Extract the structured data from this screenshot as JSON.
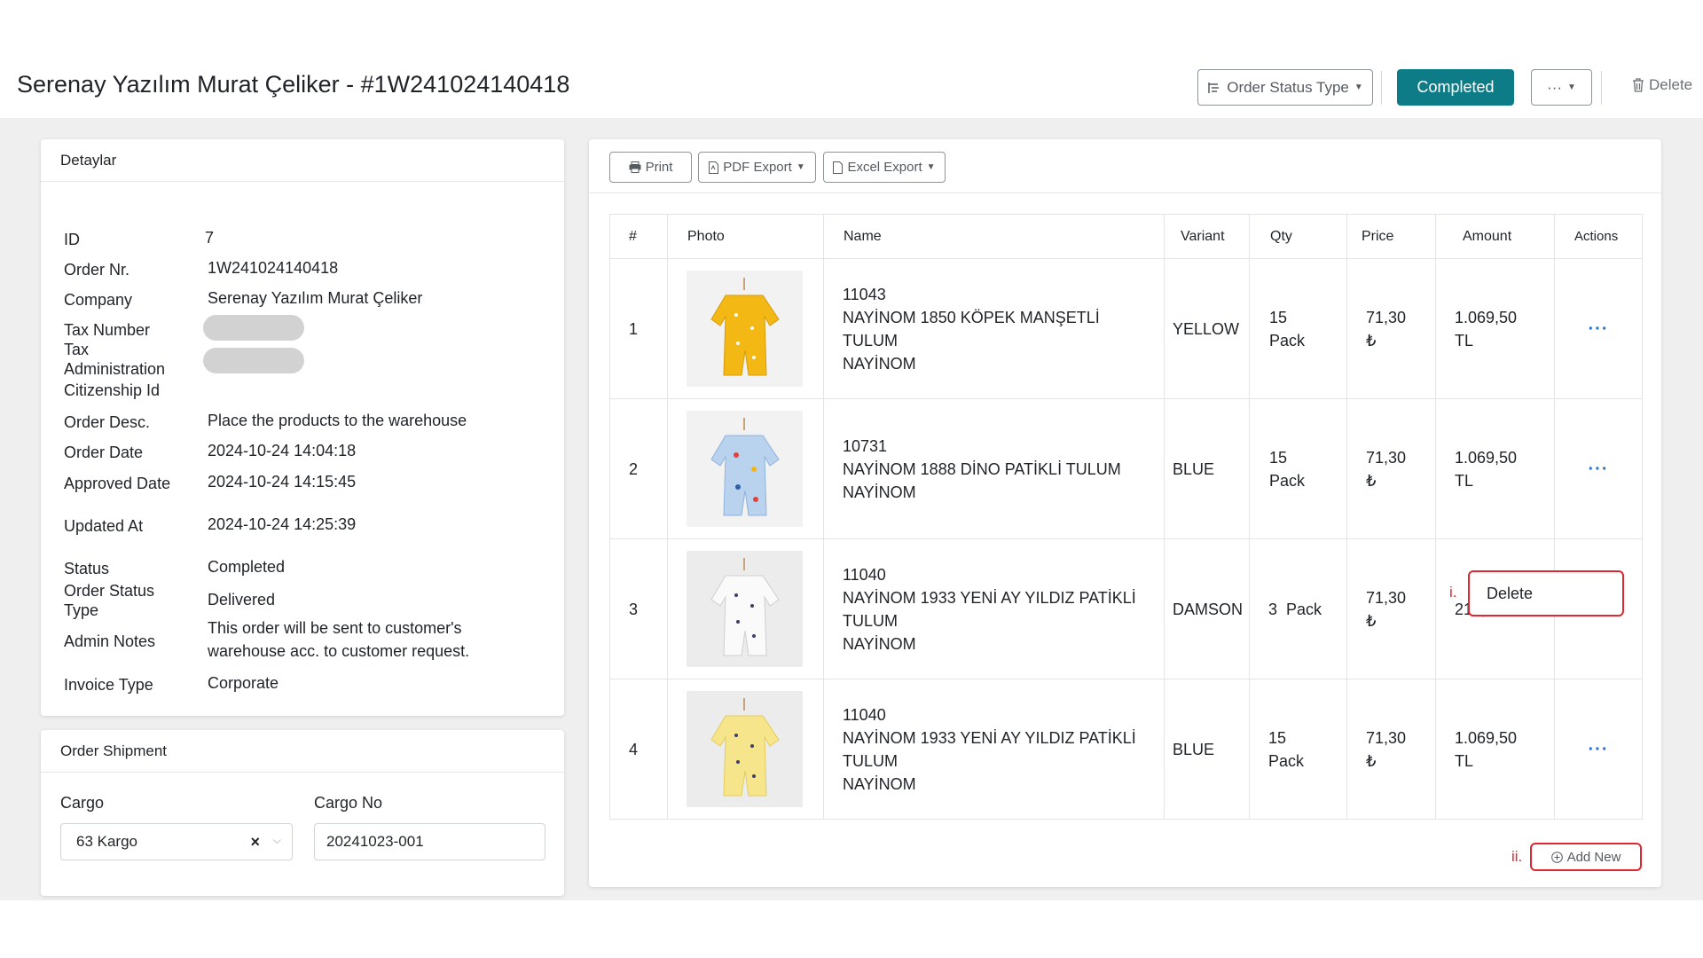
{
  "header": {
    "title": "Serenay Yazılım Murat Çeliker - #1W241024140418",
    "order_status_type_label": "Order Status Type",
    "completed_label": "Completed",
    "more_label": "···",
    "delete_label": "Delete"
  },
  "details": {
    "title": "Detaylar",
    "labels": {
      "id": "ID",
      "order_nr": "Order Nr.",
      "company": "Company",
      "tax_number": "Tax Number",
      "tax_administration": "Tax Administration",
      "citizenship_id": "Citizenship Id",
      "order_desc": "Order Desc.",
      "order_date": "Order Date",
      "approved_date": "Approved Date",
      "updated_at": "Updated At",
      "status": "Status",
      "order_status_type": "Order Status Type",
      "admin_notes": "Admin Notes",
      "invoice_type": "Invoice Type"
    },
    "values": {
      "id": "7",
      "order_nr": "1W241024140418",
      "company": "Serenay Yazılım Murat Çeliker",
      "order_desc": "Place the products to the warehouse",
      "order_date": "2024-10-24 14:04:18",
      "approved_date": "2024-10-24 14:15:45",
      "updated_at": "2024-10-24 14:25:39",
      "status": "Completed",
      "order_status_type": "Delivered",
      "admin_notes_line1": "This order will be sent to customer's",
      "admin_notes_line2": "warehouse acc. to customer request.",
      "invoice_type": "Corporate"
    }
  },
  "shipment": {
    "title": "Order Shipment",
    "cargo_label": "Cargo",
    "cargo_value": "63 Kargo",
    "cargo_no_label": "Cargo No",
    "cargo_no_value": "20241023-001"
  },
  "toolbar": {
    "print_label": "Print",
    "pdf_label": "PDF Export",
    "excel_label": "Excel Export"
  },
  "table": {
    "headers": {
      "num": "#",
      "photo": "Photo",
      "name": "Name",
      "variant": "Variant",
      "qty": "Qty",
      "price": "Price",
      "amount": "Amount",
      "actions": "Actions"
    },
    "rows": [
      {
        "num": "1",
        "code": "11043",
        "name_line1": "NAYİNOM 1850 KÖPEK MANŞETLİ",
        "name_line2": "TULUM",
        "brand": "NAYİNOM",
        "variant": "YELLOW",
        "qty_num": "15",
        "qty_unit": "Pack",
        "price_value": "71,30",
        "price_currency": "₺",
        "amount_value": "1.069,50",
        "amount_currency": "TL",
        "photo_color": "#f3b813"
      },
      {
        "num": "2",
        "code": "10731",
        "name_line1": "NAYİNOM 1888 DİNO PATİKLİ TULUM",
        "name_line2": "",
        "brand": "NAYİNOM",
        "variant": "BLUE",
        "qty_num": "15",
        "qty_unit": "Pack",
        "price_value": "71,30",
        "price_currency": "₺",
        "amount_value": "1.069,50",
        "amount_currency": "TL",
        "photo_color": "#b9d2ee"
      },
      {
        "num": "3",
        "code": "11040",
        "name_line1": "NAYİNOM 1933 YENİ AY YILDIZ PATİKLİ",
        "name_line2": "TULUM",
        "brand": "NAYİNOM",
        "variant": "DAMSON",
        "qty_inline": "3  Pack",
        "price_value": "71,30",
        "price_currency": "₺",
        "amount_inline": "213,90 TL",
        "photo_color": "#f7f7f7"
      },
      {
        "num": "4",
        "code": "11040",
        "name_line1": "NAYİNOM 1933 YENİ AY YILDIZ PATİKLİ",
        "name_line2": "TULUM",
        "brand": "NAYİNOM",
        "variant": "BLUE",
        "qty_num": "15",
        "qty_unit": "Pack",
        "price_value": "71,30",
        "price_currency": "₺",
        "amount_value": "1.069,50",
        "amount_currency": "TL",
        "photo_color": "#f6e58a"
      }
    ],
    "row_actions_label": "···"
  },
  "dropdown": {
    "delete_label": "Delete",
    "marker": "i."
  },
  "add_new": {
    "label": "Add New",
    "marker": "ii."
  },
  "colors": {
    "accent": "#0e7c86",
    "highlight": "#e0262f",
    "link": "#1f6fd1"
  }
}
